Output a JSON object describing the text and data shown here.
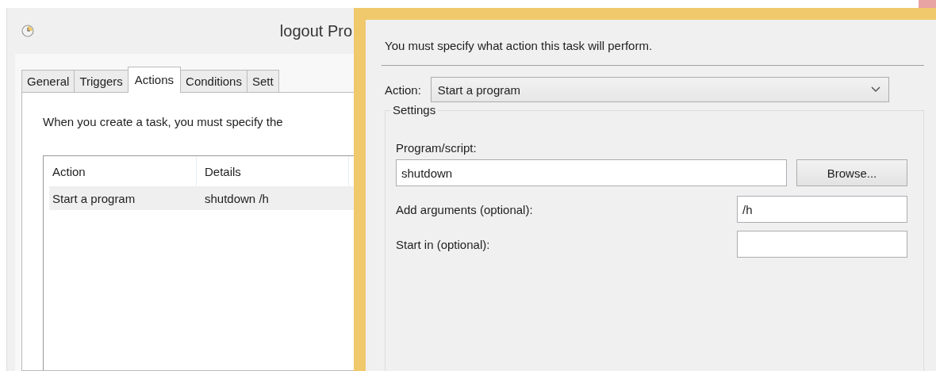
{
  "main_window": {
    "title": "logout Pro",
    "tabs": [
      {
        "label": "General",
        "selected": false
      },
      {
        "label": "Triggers",
        "selected": false
      },
      {
        "label": "Actions",
        "selected": true
      },
      {
        "label": "Conditions",
        "selected": false
      },
      {
        "label": "Sett",
        "selected": false
      }
    ],
    "description": "When you create a task, you must specify the",
    "table": {
      "columns": [
        "Action",
        "Details"
      ],
      "rows": [
        {
          "cells": [
            "Start a program",
            "shutdown /h"
          ],
          "selected": true
        }
      ]
    }
  },
  "dialog": {
    "instruction": "You must specify what action this task will perform.",
    "action": {
      "label": "Action:",
      "value": "Start a program"
    },
    "settings": {
      "title": "Settings",
      "program": {
        "label": "Program/script:",
        "value": "shutdown"
      },
      "browse_button": "Browse...",
      "arguments": {
        "label": "Add arguments (optional):",
        "value": "/h"
      },
      "start_in": {
        "label": "Start in (optional):"
      }
    }
  }
}
